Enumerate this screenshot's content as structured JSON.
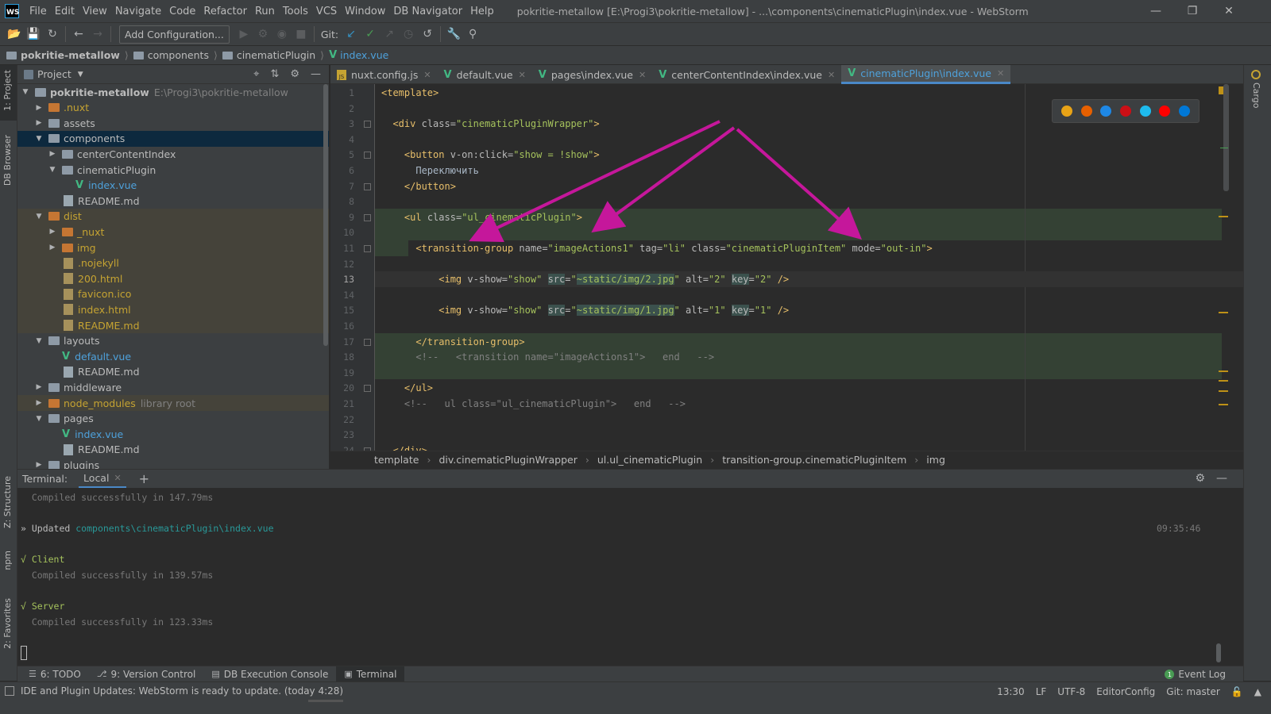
{
  "app": {
    "logo": "WS",
    "window_title": "pokritie-metallow [E:\\Progi3\\pokritie-metallow] - ...\\components\\cinematicPlugin\\index.vue - WebStorm"
  },
  "menu": [
    "File",
    "Edit",
    "View",
    "Navigate",
    "Code",
    "Refactor",
    "Run",
    "Tools",
    "VCS",
    "Window",
    "DB Navigator",
    "Help"
  ],
  "toolbar": {
    "add_config_label": "Add Configuration...",
    "git_label": "Git:",
    "icons": [
      "open-icon",
      "save-icon",
      "sync-icon",
      "back-icon",
      "forward-icon",
      "run-icon",
      "debug-icon",
      "coverage-icon",
      "stop-icon",
      "git-update-icon",
      "git-commit-icon",
      "git-push-icon",
      "history-icon",
      "rollback-icon",
      "settings-wrench-icon",
      "search-icon"
    ]
  },
  "breadcrumb": [
    "pokritie-metallow",
    "components",
    "cinematicPlugin",
    "index.vue"
  ],
  "left_stripe": {
    "project": "1: Project",
    "db_browser": "DB Browser",
    "structure": "Z: Structure",
    "npm": "npm",
    "favorites": "2: Favorites"
  },
  "right_stripe": {
    "cargo": "Cargo"
  },
  "project_panel": {
    "title": "Project",
    "tree": [
      {
        "label": "pokritie-metallow",
        "path": "E:\\Progi3\\pokritie-metallow",
        "kind": "folder",
        "state": "expanded",
        "depth": 0,
        "bold": true
      },
      {
        "label": ".nuxt",
        "kind": "folder",
        "state": "collapsed",
        "depth": 1,
        "style": "orange"
      },
      {
        "label": "assets",
        "kind": "folder",
        "state": "collapsed",
        "depth": 1
      },
      {
        "label": "components",
        "kind": "folder",
        "state": "expanded",
        "depth": 1,
        "selected": true
      },
      {
        "label": "centerContentIndex",
        "kind": "folder",
        "state": "collapsed",
        "depth": 2
      },
      {
        "label": "cinematicPlugin",
        "kind": "folder",
        "state": "expanded",
        "depth": 2
      },
      {
        "label": "index.vue",
        "kind": "vue",
        "depth": 3,
        "style": "blue"
      },
      {
        "label": "README.md",
        "kind": "file",
        "depth": 2
      },
      {
        "label": "dist",
        "kind": "folder",
        "state": "expanded",
        "depth": 1,
        "style": "orange",
        "excluded": true
      },
      {
        "label": "_nuxt",
        "kind": "folder",
        "state": "collapsed",
        "depth": 2,
        "style": "orange",
        "excluded": true
      },
      {
        "label": "img",
        "kind": "folder",
        "state": "collapsed",
        "depth": 2,
        "style": "orange",
        "excluded": true
      },
      {
        "label": ".nojekyll",
        "kind": "file",
        "depth": 2,
        "style": "orange",
        "excluded": true
      },
      {
        "label": "200.html",
        "kind": "file",
        "depth": 2,
        "style": "orange",
        "excluded": true
      },
      {
        "label": "favicon.ico",
        "kind": "file",
        "depth": 2,
        "style": "orange",
        "excluded": true
      },
      {
        "label": "index.html",
        "kind": "file",
        "depth": 2,
        "style": "orange",
        "excluded": true
      },
      {
        "label": "README.md",
        "kind": "file",
        "depth": 2,
        "style": "orange",
        "excluded": true
      },
      {
        "label": "layouts",
        "kind": "folder",
        "state": "expanded",
        "depth": 1
      },
      {
        "label": "default.vue",
        "kind": "vue",
        "depth": 2,
        "style": "blue"
      },
      {
        "label": "README.md",
        "kind": "file",
        "depth": 2
      },
      {
        "label": "middleware",
        "kind": "folder",
        "state": "collapsed",
        "depth": 1
      },
      {
        "label": "node_modules",
        "suffix": "library root",
        "kind": "folder",
        "state": "collapsed",
        "depth": 1,
        "style": "orange",
        "excluded": true
      },
      {
        "label": "pages",
        "kind": "folder",
        "state": "expanded",
        "depth": 1
      },
      {
        "label": "index.vue",
        "kind": "vue",
        "depth": 2,
        "style": "blue"
      },
      {
        "label": "README.md",
        "kind": "file",
        "depth": 2
      },
      {
        "label": "plugins",
        "kind": "folder",
        "state": "collapsed",
        "depth": 1
      }
    ]
  },
  "editor_tabs": [
    {
      "label": "nuxt.config.js",
      "kind": "js",
      "active": false
    },
    {
      "label": "default.vue",
      "kind": "vue",
      "active": false
    },
    {
      "label": "pages\\index.vue",
      "kind": "vue",
      "active": false
    },
    {
      "label": "centerContentIndex\\index.vue",
      "kind": "vue",
      "active": false
    },
    {
      "label": "cinematicPlugin\\index.vue",
      "kind": "vue",
      "active": true
    }
  ],
  "editor": {
    "current_line": 13,
    "lines": [
      {
        "n": 1,
        "html": "<span class='tg'>&lt;template&gt;</span>"
      },
      {
        "n": 2,
        "html": ""
      },
      {
        "n": 3,
        "html": "  <span class='tg'>&lt;div</span> <span class='at'>class=</span><span class='st'>\"cinematicPluginWrapper\"</span><span class='tg'>&gt;</span>"
      },
      {
        "n": 4,
        "html": ""
      },
      {
        "n": 5,
        "html": "    <span class='tg'>&lt;button</span> <span class='at'>v-on:click=</span><span class='st'>\"show = !show\"</span><span class='tg'>&gt;</span>"
      },
      {
        "n": 6,
        "html": "      <span class='txt'>Переключить</span>"
      },
      {
        "n": 7,
        "html": "    <span class='tg'>&lt;/button&gt;</span>"
      },
      {
        "n": 8,
        "html": ""
      },
      {
        "n": 9,
        "html": "    <span class='tg'>&lt;ul</span> <span class='at'>class=</span><span class='st'>\"ul_cinematicPlugin\"</span><span class='tg'>&gt;</span>"
      },
      {
        "n": 10,
        "html": ""
      },
      {
        "n": 11,
        "html": "      <span class='tg'>&lt;transition-group</span> <span class='at'>name=</span><span class='st'>\"imageActions1\"</span> <span class='at'>tag=</span><span class='st'>\"li\"</span> <span class='at'>class=</span><span class='st'>\"cinematicPluginItem\"</span> <span class='at'>mode=</span><span class='st'>\"out-in\"</span><span class='tg'>&gt;</span>"
      },
      {
        "n": 12,
        "html": ""
      },
      {
        "n": 13,
        "html": "          <span class='tg'>&lt;img</span> <span class='at'>v-show=</span><span class='st'>\"show\"</span> <span class='at mk'>src</span><span class='at'>=</span><span class='st'>\"<span class='mk'>~static/img/2.jpg</span>\"</span> <span class='at'>alt=</span><span class='st'>\"2\"</span> <span class='at mk'>key</span><span class='at'>=</span><span class='st'>\"2\"</span> <span class='tg'>/&gt;</span>"
      },
      {
        "n": 14,
        "html": ""
      },
      {
        "n": 15,
        "html": "          <span class='tg'>&lt;img</span> <span class='at'>v-show=</span><span class='st'>\"show\"</span> <span class='at mk'>src</span><span class='at'>=</span><span class='st'>\"<span class='mk'>~static/img/1.jpg</span>\"</span> <span class='at'>alt=</span><span class='st'>\"1\"</span> <span class='at mk'>key</span><span class='at'>=</span><span class='st'>\"1\"</span> <span class='tg'>/&gt;</span>"
      },
      {
        "n": 16,
        "html": ""
      },
      {
        "n": 17,
        "html": "      <span class='tg'>&lt;/transition-group&gt;</span>"
      },
      {
        "n": 18,
        "html": "      <span class='cm'>&lt;!--   &lt;transition name=\"imageActions1\"&gt;   end   --&gt;</span>"
      },
      {
        "n": 19,
        "html": ""
      },
      {
        "n": 20,
        "html": "    <span class='tg'>&lt;/ul&gt;</span>"
      },
      {
        "n": 21,
        "html": "    <span class='cm'>&lt;!--   ul class=\"ul_cinematicPlugin\"&gt;   end   --&gt;</span>"
      },
      {
        "n": 22,
        "html": ""
      },
      {
        "n": 23,
        "html": ""
      },
      {
        "n": 24,
        "html": "  <span class='tg'>&lt;/div&gt;</span>"
      }
    ],
    "browsers": [
      "chrome-icon",
      "firefox-icon",
      "safari-icon",
      "opera-icon",
      "ie-icon",
      "yandex-icon",
      "edge-icon"
    ]
  },
  "editor_breadcrumb": [
    "template",
    "div.cinematicPluginWrapper",
    "ul.ul_cinematicPlugin",
    "transition-group.cinematicPluginItem",
    "img"
  ],
  "terminal": {
    "label": "Terminal:",
    "tab": "Local",
    "lines": [
      {
        "text": "  Compiled successfully in 147.79ms",
        "cls": "t-dim",
        "row": 0
      },
      {
        "prefix": "» Updated ",
        "link": "components\\cinematicPlugin\\index.vue",
        "time": "09:35:46",
        "row": 2
      },
      {
        "text": "√ Client",
        "cls": "t-ok",
        "row": 4
      },
      {
        "text": "  Compiled successfully in 139.57ms",
        "cls": "t-dim",
        "row": 5
      },
      {
        "text": "√ Server",
        "cls": "t-ok",
        "row": 7
      },
      {
        "text": "  Compiled successfully in 123.33ms",
        "cls": "t-dim",
        "row": 8
      }
    ]
  },
  "tool_tabs": [
    {
      "label": "6: TODO",
      "icon": "todo-icon",
      "active": false
    },
    {
      "label": "9: Version Control",
      "icon": "vcs-icon",
      "active": false
    },
    {
      "label": "DB Execution Console",
      "icon": "db-console-icon",
      "active": false
    },
    {
      "label": "Terminal",
      "icon": "terminal-icon",
      "active": true
    }
  ],
  "event_log": {
    "label": "Event Log",
    "count": "1"
  },
  "status": {
    "message": "IDE and Plugin Updates: WebStorm is ready to update. (today 4:28)",
    "position": "13:30",
    "line_sep": "LF",
    "encoding": "UTF-8",
    "editorconfig": "EditorConfig",
    "git": "Git: master"
  },
  "colors": {
    "accent": "#4a88c7",
    "annotation_arrow": "#c5179b",
    "vue_green": "#42b883"
  }
}
